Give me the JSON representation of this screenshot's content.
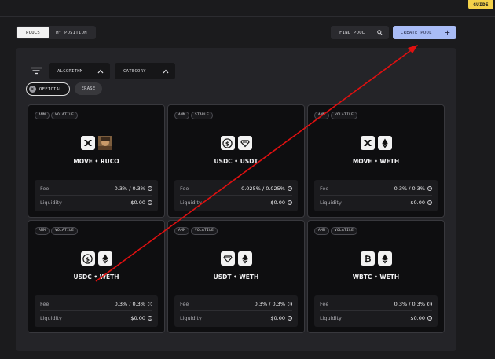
{
  "header": {
    "guide_label": "GUIDE"
  },
  "tabs": [
    {
      "label": "POOLS",
      "active": true
    },
    {
      "label": "MY POSITION",
      "active": false
    }
  ],
  "find_pool": {
    "label": "FIND POOL",
    "icon": "search-icon"
  },
  "create_pool": {
    "label": "CREATE POOL",
    "icon": "plus-icon"
  },
  "filters": {
    "filter_icon": "filter-lines-icon",
    "algorithm_label": "ALGORITHM",
    "category_label": "CATEGORY",
    "official_chip": "OFFICIAL",
    "erase_label": "ERASE"
  },
  "colors": {
    "accent": "#a9bcf6",
    "guide": "#f4d24a",
    "annotation_arrow": "#e01010"
  },
  "pools": [
    {
      "badges": [
        "AMM",
        "VOLATILE"
      ],
      "tokens": [
        "move-icon",
        "ruco-avatar"
      ],
      "pair": "MOVE • RUCO",
      "fee_label": "Fee",
      "fee": "0.3% / 0.3%",
      "liquidity_label": "Liquidity",
      "liquidity": "$0.00"
    },
    {
      "badges": [
        "AMM",
        "STABLE"
      ],
      "tokens": [
        "usdc-icon",
        "usdt-icon"
      ],
      "pair": "USDC • USDT",
      "fee_label": "Fee",
      "fee": "0.025% / 0.025%",
      "liquidity_label": "Liquidity",
      "liquidity": "$0.00"
    },
    {
      "badges": [
        "AMM",
        "VOLATILE"
      ],
      "tokens": [
        "move-icon",
        "weth-icon"
      ],
      "pair": "MOVE • WETH",
      "fee_label": "Fee",
      "fee": "0.3% / 0.3%",
      "liquidity_label": "Liquidity",
      "liquidity": "$0.00"
    },
    {
      "badges": [
        "AMM",
        "VOLATILE"
      ],
      "tokens": [
        "usdc-icon",
        "weth-icon"
      ],
      "pair": "USDC • WETH",
      "fee_label": "Fee",
      "fee": "0.3% / 0.3%",
      "liquidity_label": "Liquidity",
      "liquidity": "$0.00"
    },
    {
      "badges": [
        "AMM",
        "VOLATILE"
      ],
      "tokens": [
        "usdt-icon",
        "weth-icon"
      ],
      "pair": "USDT • WETH",
      "fee_label": "Fee",
      "fee": "0.3% / 0.3%",
      "liquidity_label": "Liquidity",
      "liquidity": "$0.00"
    },
    {
      "badges": [
        "AMM",
        "VOLATILE"
      ],
      "tokens": [
        "wbtc-icon",
        "weth-icon"
      ],
      "pair": "WBTC • WETH",
      "fee_label": "Fee",
      "fee": "0.3% / 0.3%",
      "liquidity_label": "Liquidity",
      "liquidity": "$0.00"
    }
  ]
}
